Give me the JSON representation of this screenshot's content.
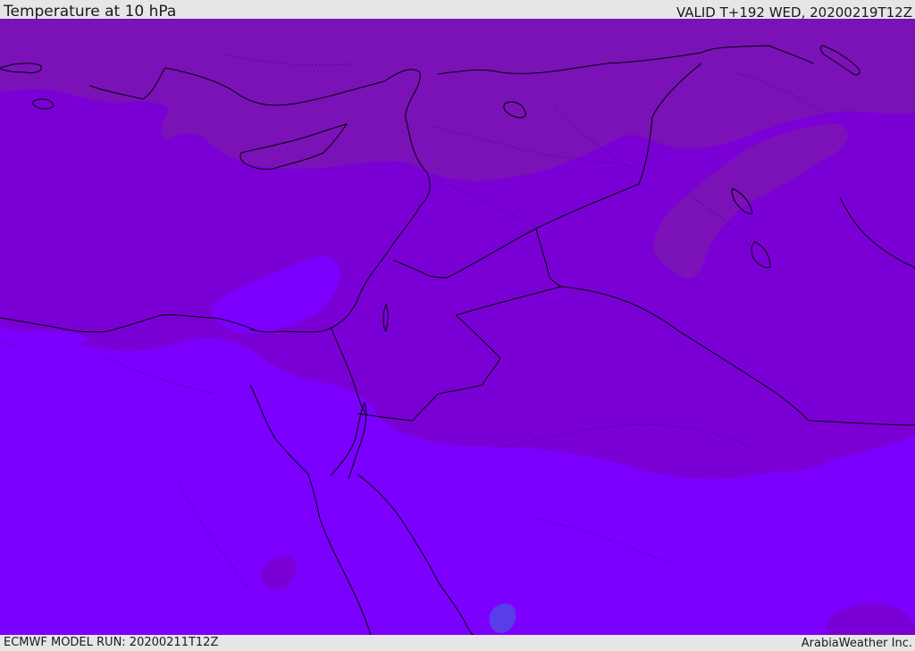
{
  "header": {
    "title": "Temperature at 10 hPa",
    "valid_time": "VALID T+192 WED, 20200219T12Z"
  },
  "footer": {
    "model_run": "ECMWF MODEL RUN: 20200211T12Z",
    "credit": "ArabiaWeather Inc."
  },
  "map": {
    "variable": "temperature",
    "level_hpa": 10,
    "region": "Eastern Mediterranean / Middle East",
    "colors": {
      "band_cold": "#7a12b8",
      "band_mid": "#7b00d6",
      "band_warm": "#7b00ff",
      "cell_blue": "#5a3ce8",
      "coastline": "#000000"
    }
  }
}
